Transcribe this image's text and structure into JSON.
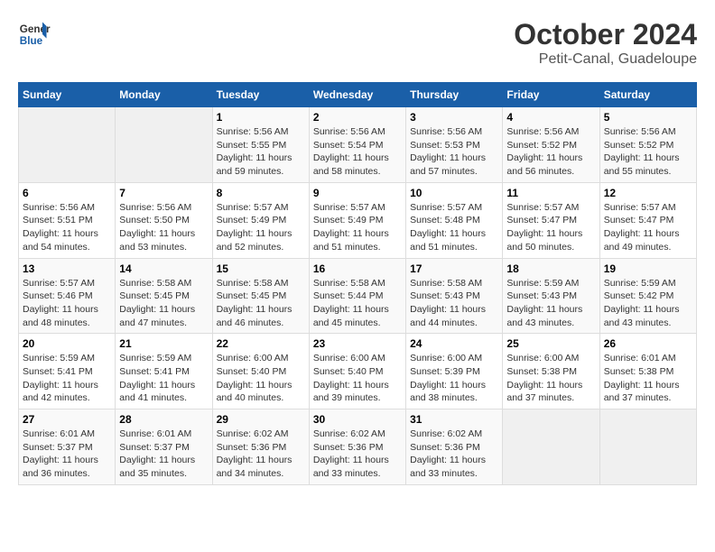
{
  "header": {
    "logo_line1": "General",
    "logo_line2": "Blue",
    "title": "October 2024",
    "subtitle": "Petit-Canal, Guadeloupe"
  },
  "weekdays": [
    "Sunday",
    "Monday",
    "Tuesday",
    "Wednesday",
    "Thursday",
    "Friday",
    "Saturday"
  ],
  "weeks": [
    [
      {
        "day": "",
        "info": ""
      },
      {
        "day": "",
        "info": ""
      },
      {
        "day": "1",
        "info": "Sunrise: 5:56 AM\nSunset: 5:55 PM\nDaylight: 11 hours and 59 minutes."
      },
      {
        "day": "2",
        "info": "Sunrise: 5:56 AM\nSunset: 5:54 PM\nDaylight: 11 hours and 58 minutes."
      },
      {
        "day": "3",
        "info": "Sunrise: 5:56 AM\nSunset: 5:53 PM\nDaylight: 11 hours and 57 minutes."
      },
      {
        "day": "4",
        "info": "Sunrise: 5:56 AM\nSunset: 5:52 PM\nDaylight: 11 hours and 56 minutes."
      },
      {
        "day": "5",
        "info": "Sunrise: 5:56 AM\nSunset: 5:52 PM\nDaylight: 11 hours and 55 minutes."
      }
    ],
    [
      {
        "day": "6",
        "info": "Sunrise: 5:56 AM\nSunset: 5:51 PM\nDaylight: 11 hours and 54 minutes."
      },
      {
        "day": "7",
        "info": "Sunrise: 5:56 AM\nSunset: 5:50 PM\nDaylight: 11 hours and 53 minutes."
      },
      {
        "day": "8",
        "info": "Sunrise: 5:57 AM\nSunset: 5:49 PM\nDaylight: 11 hours and 52 minutes."
      },
      {
        "day": "9",
        "info": "Sunrise: 5:57 AM\nSunset: 5:49 PM\nDaylight: 11 hours and 51 minutes."
      },
      {
        "day": "10",
        "info": "Sunrise: 5:57 AM\nSunset: 5:48 PM\nDaylight: 11 hours and 51 minutes."
      },
      {
        "day": "11",
        "info": "Sunrise: 5:57 AM\nSunset: 5:47 PM\nDaylight: 11 hours and 50 minutes."
      },
      {
        "day": "12",
        "info": "Sunrise: 5:57 AM\nSunset: 5:47 PM\nDaylight: 11 hours and 49 minutes."
      }
    ],
    [
      {
        "day": "13",
        "info": "Sunrise: 5:57 AM\nSunset: 5:46 PM\nDaylight: 11 hours and 48 minutes."
      },
      {
        "day": "14",
        "info": "Sunrise: 5:58 AM\nSunset: 5:45 PM\nDaylight: 11 hours and 47 minutes."
      },
      {
        "day": "15",
        "info": "Sunrise: 5:58 AM\nSunset: 5:45 PM\nDaylight: 11 hours and 46 minutes."
      },
      {
        "day": "16",
        "info": "Sunrise: 5:58 AM\nSunset: 5:44 PM\nDaylight: 11 hours and 45 minutes."
      },
      {
        "day": "17",
        "info": "Sunrise: 5:58 AM\nSunset: 5:43 PM\nDaylight: 11 hours and 44 minutes."
      },
      {
        "day": "18",
        "info": "Sunrise: 5:59 AM\nSunset: 5:43 PM\nDaylight: 11 hours and 43 minutes."
      },
      {
        "day": "19",
        "info": "Sunrise: 5:59 AM\nSunset: 5:42 PM\nDaylight: 11 hours and 43 minutes."
      }
    ],
    [
      {
        "day": "20",
        "info": "Sunrise: 5:59 AM\nSunset: 5:41 PM\nDaylight: 11 hours and 42 minutes."
      },
      {
        "day": "21",
        "info": "Sunrise: 5:59 AM\nSunset: 5:41 PM\nDaylight: 11 hours and 41 minutes."
      },
      {
        "day": "22",
        "info": "Sunrise: 6:00 AM\nSunset: 5:40 PM\nDaylight: 11 hours and 40 minutes."
      },
      {
        "day": "23",
        "info": "Sunrise: 6:00 AM\nSunset: 5:40 PM\nDaylight: 11 hours and 39 minutes."
      },
      {
        "day": "24",
        "info": "Sunrise: 6:00 AM\nSunset: 5:39 PM\nDaylight: 11 hours and 38 minutes."
      },
      {
        "day": "25",
        "info": "Sunrise: 6:00 AM\nSunset: 5:38 PM\nDaylight: 11 hours and 37 minutes."
      },
      {
        "day": "26",
        "info": "Sunrise: 6:01 AM\nSunset: 5:38 PM\nDaylight: 11 hours and 37 minutes."
      }
    ],
    [
      {
        "day": "27",
        "info": "Sunrise: 6:01 AM\nSunset: 5:37 PM\nDaylight: 11 hours and 36 minutes."
      },
      {
        "day": "28",
        "info": "Sunrise: 6:01 AM\nSunset: 5:37 PM\nDaylight: 11 hours and 35 minutes."
      },
      {
        "day": "29",
        "info": "Sunrise: 6:02 AM\nSunset: 5:36 PM\nDaylight: 11 hours and 34 minutes."
      },
      {
        "day": "30",
        "info": "Sunrise: 6:02 AM\nSunset: 5:36 PM\nDaylight: 11 hours and 33 minutes."
      },
      {
        "day": "31",
        "info": "Sunrise: 6:02 AM\nSunset: 5:36 PM\nDaylight: 11 hours and 33 minutes."
      },
      {
        "day": "",
        "info": ""
      },
      {
        "day": "",
        "info": ""
      }
    ]
  ]
}
